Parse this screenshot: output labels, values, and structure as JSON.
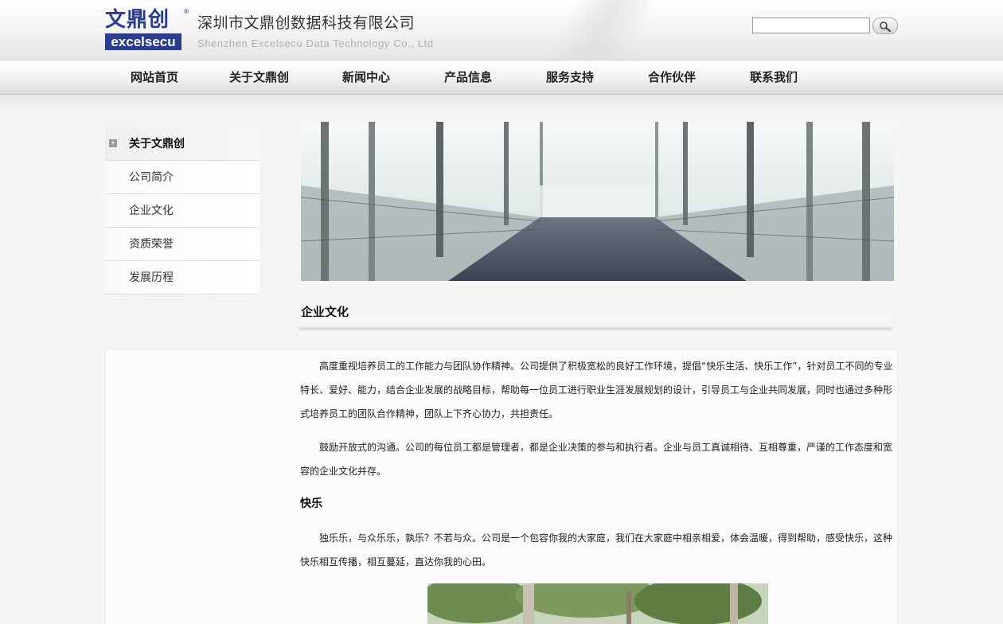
{
  "header": {
    "logo_cn": "文鼎创",
    "logo_en": "excelsecu",
    "company_name_cn": "深圳市文鼎创数据科技有限公司",
    "company_name_en": "Shenzhen Excelsecu Data Technology Co., Ltd",
    "search": {
      "value": "",
      "placeholder": ""
    }
  },
  "nav": {
    "items": [
      "网站首页",
      "关于文鼎创",
      "新闻中心",
      "产品信息",
      "服务支持",
      "合作伙伴",
      "联系我们"
    ]
  },
  "sidebar": {
    "title": "关于文鼎创",
    "items": [
      "公司简介",
      "企业文化",
      "资质荣誉",
      "发展历程"
    ]
  },
  "main": {
    "section_title": "企业文化",
    "paragraphs": [
      "高度重视培养员工的工作能力与团队协作精神。公司提供了积极宽松的良好工作环境，提倡“快乐生活、快乐工作”，针对员工不同的专业特长、爱好、能力，结合企业发展的战略目标，帮助每一位员工进行职业生涯发展规划的设计，引导员工与企业共同发展，同时也通过多种形式培养员工的团队合作精神，团队上下齐心协力，共担责任。",
      "鼓励开放式的沟通。公司的每位员工都是管理者，都是企业决策的参与和执行者。企业与员工真诚相待、互相尊重，严谨的工作态度和宽容的企业文化并存。"
    ],
    "sub_title": "快乐",
    "sub_paragraph": "独乐乐，与众乐乐，孰乐？不若与众。公司是一个包容你我的大家庭，我们在大家庭中相亲相爱，体会温暖，得到帮助，感受快乐，这种快乐相互传播，相互蔓延，直达你我的心田。"
  },
  "icons": {
    "search_button": "magnifier-icon",
    "sidebar_toggle": "plus-box-icon"
  },
  "colors": {
    "brand_blue": "#2a3c8f"
  }
}
